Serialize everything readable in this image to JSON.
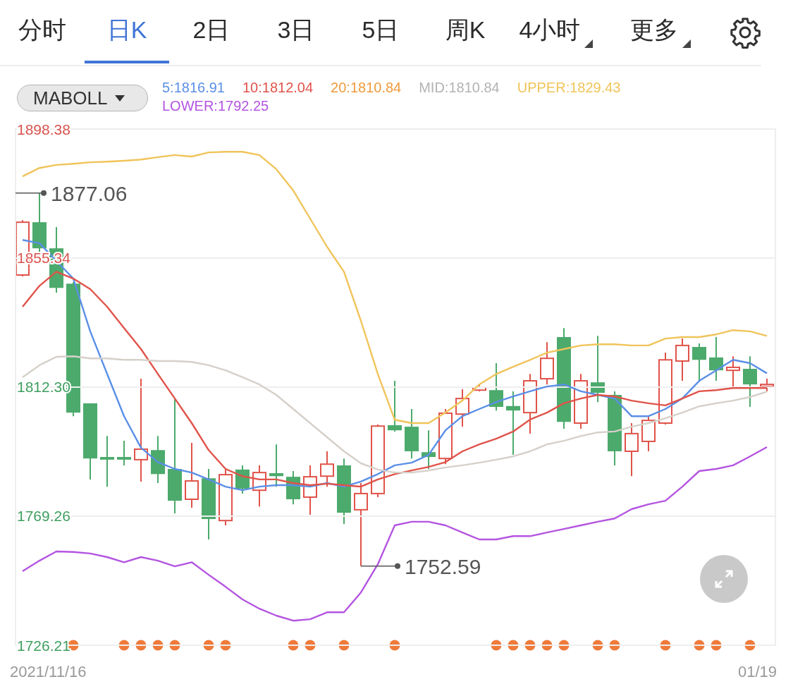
{
  "tabs": [
    {
      "label": "分时",
      "selected": false,
      "has_menu": false
    },
    {
      "label": "日K",
      "selected": true,
      "has_menu": false
    },
    {
      "label": "2日",
      "selected": false,
      "has_menu": false
    },
    {
      "label": "3日",
      "selected": false,
      "has_menu": false
    },
    {
      "label": "5日",
      "selected": false,
      "has_menu": false
    },
    {
      "label": "周K",
      "selected": false,
      "has_menu": false
    },
    {
      "label": "4小时",
      "selected": false,
      "has_menu": true
    },
    {
      "label": "更多",
      "selected": false,
      "has_menu": true
    }
  ],
  "indicator": {
    "label": "MABOLL"
  },
  "legend": [
    {
      "text": "5:1816.91",
      "color": "#5b8fe6"
    },
    {
      "text": "10:1812.04",
      "color": "#e0534a"
    },
    {
      "text": "20:1810.84",
      "color": "#ef9a3c"
    },
    {
      "text": "MID:1810.84",
      "color": "#b3b3b3"
    },
    {
      "text": "UPPER:1829.43",
      "color": "#f0c45a"
    },
    {
      "text": "LOWER:1792.25",
      "color": "#b455e0"
    }
  ],
  "chart": {
    "chart_data": {
      "type": "line",
      "ylim": [
        1726.21,
        1898.38
      ],
      "grid": true,
      "yticks": [
        {
          "value": 1898.38,
          "label": "1898.38"
        },
        {
          "value": 1855.34,
          "label": "1855.34"
        },
        {
          "value": 1812.3,
          "label": "1812.30"
        },
        {
          "value": 1769.26,
          "label": "1769.26"
        },
        {
          "value": 1726.21,
          "label": "1726.21"
        }
      ],
      "series": [
        {
          "color": "#5b8fe6",
          "values": [
            1861.4,
            1860.3,
            1854.4,
            1848.5,
            1830.9,
            1816.7,
            1802.6,
            1792.1,
            1787.3,
            1785.0,
            1783.8,
            1781.5,
            1779.1,
            1777.9,
            1779.1,
            1779.6,
            1779.6,
            1779.1,
            1780.3,
            1779.1,
            1780.8,
            1783.3,
            1786.2,
            1787.1,
            1789.7,
            1797.9,
            1802.6,
            1805.0,
            1807.3,
            1809.2,
            1810.9,
            1812.5,
            1813.2,
            1810.9,
            1809.7,
            1808.5,
            1802.6,
            1802.6,
            1805.0,
            1808.5,
            1814.4,
            1817.9,
            1821.4,
            1820.3,
            1816.9
          ]
        },
        {
          "color": "#e0534a",
          "values": [
            1839.1,
            1846.1,
            1850.8,
            1848.5,
            1845.0,
            1839.1,
            1832.0,
            1825.0,
            1816.7,
            1808.5,
            1800.3,
            1791.3,
            1785.0,
            1782.6,
            1781.5,
            1781.5,
            1780.3,
            1779.6,
            1780.1,
            1779.6,
            1779.1,
            1781.5,
            1783.3,
            1784.5,
            1785.7,
            1787.3,
            1790.9,
            1793.2,
            1795.1,
            1797.5,
            1801.5,
            1803.8,
            1806.9,
            1808.5,
            1809.7,
            1809.2,
            1807.8,
            1806.9,
            1806.2,
            1808.5,
            1810.9,
            1811.3,
            1812.0,
            1812.0,
            1812.0
          ]
        },
        {
          "color": "#d6d0ca",
          "values": [
            1815.6,
            1819.6,
            1822.4,
            1822.6,
            1821.9,
            1821.9,
            1821.4,
            1821.4,
            1821.0,
            1821.0,
            1820.7,
            1819.6,
            1817.9,
            1815.6,
            1813.2,
            1809.7,
            1805.0,
            1800.3,
            1795.6,
            1790.9,
            1786.9,
            1784.8,
            1783.8,
            1783.8,
            1784.5,
            1785.5,
            1786.2,
            1787.1,
            1788.1,
            1789.2,
            1790.9,
            1793.2,
            1794.4,
            1796.0,
            1797.2,
            1797.5,
            1799.1,
            1800.3,
            1801.9,
            1803.8,
            1805.9,
            1806.9,
            1807.8,
            1809.0,
            1810.8
          ]
        },
        {
          "color": "#f0c45a",
          "values": [
            1882.6,
            1885.4,
            1886.4,
            1886.8,
            1887.3,
            1887.5,
            1887.8,
            1888.2,
            1889.0,
            1889.7,
            1889.2,
            1890.6,
            1890.8,
            1890.8,
            1889.7,
            1885.0,
            1877.9,
            1868.5,
            1859.1,
            1850.8,
            1834.4,
            1816.7,
            1801.4,
            1800.3,
            1800.3,
            1803.8,
            1807.8,
            1813.2,
            1816.7,
            1819.1,
            1821.4,
            1823.8,
            1825.0,
            1826.2,
            1826.6,
            1826.6,
            1826.2,
            1826.2,
            1828.5,
            1829.0,
            1829.0,
            1829.9,
            1831.3,
            1830.9,
            1829.4
          ]
        },
        {
          "color": "#b455e0",
          "values": [
            1750.9,
            1754.4,
            1757.5,
            1757.3,
            1756.8,
            1755.6,
            1753.9,
            1755.6,
            1754.4,
            1752.5,
            1753.9,
            1749.7,
            1745.7,
            1741.5,
            1738.4,
            1736.1,
            1734.4,
            1734.9,
            1737.2,
            1737.2,
            1743.8,
            1753.2,
            1766.2,
            1767.4,
            1767.4,
            1766.2,
            1763.8,
            1761.5,
            1761.5,
            1762.6,
            1762.6,
            1763.8,
            1765.0,
            1766.2,
            1767.4,
            1768.5,
            1771.6,
            1773.2,
            1774.4,
            1779.1,
            1784.3,
            1785.0,
            1786.2,
            1789.2,
            1792.3
          ]
        }
      ],
      "annotations": [
        {
          "text": "1877.06"
        },
        {
          "text": "1752.59"
        }
      ]
    }
  },
  "x_axis": {
    "start": "2021/11/16",
    "end": "01/19"
  }
}
